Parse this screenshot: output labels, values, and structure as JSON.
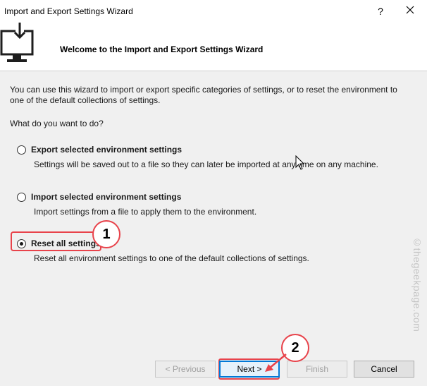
{
  "window": {
    "title": "Import and Export Settings Wizard",
    "help_glyph": "?",
    "close_icon": "close-icon"
  },
  "header": {
    "title": "Welcome to the Import and Export Settings Wizard",
    "icon": "monitor-download-icon"
  },
  "content": {
    "intro": "You can use this wizard to import or export specific categories of settings, or to reset the environment to one of the default collections of settings.",
    "question": "What do you want to do?",
    "options": [
      {
        "label": "Export selected environment settings",
        "description": "Settings will be saved out to a file so they can later be imported at any time on any machine.",
        "selected": false
      },
      {
        "label": "Import selected environment settings",
        "description": "Import settings from a file to apply them to the environment.",
        "selected": false
      },
      {
        "label": "Reset all settings",
        "description": "Reset all environment settings to one of the default collections of settings.",
        "selected": true
      }
    ]
  },
  "annotations": {
    "step1": "1",
    "step2": "2",
    "highlight_color": "#e8434b"
  },
  "watermark": "©thegeekpage.com",
  "footer": {
    "previous": "< Previous",
    "next": "Next >",
    "finish": "Finish",
    "cancel": "Cancel"
  },
  "colors": {
    "accent": "#0078d7",
    "icon": "#1e1e1e"
  }
}
